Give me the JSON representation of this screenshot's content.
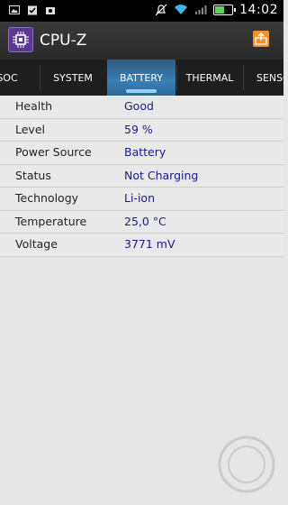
{
  "status_bar": {
    "time": "14:02",
    "battery_level": 0.59,
    "icons": [
      "image-icon",
      "clipboard-check-icon",
      "camera-icon",
      "alarm-off-icon",
      "wifi-icon",
      "signal-icon",
      "battery-icon"
    ]
  },
  "app": {
    "title": "CPU-Z"
  },
  "tabs": [
    {
      "label": "SOC"
    },
    {
      "label": "SYSTEM"
    },
    {
      "label": "BATTERY"
    },
    {
      "label": "THERMAL"
    },
    {
      "label": "SENSO"
    }
  ],
  "battery": {
    "rows": [
      {
        "label": "Health",
        "value": "Good"
      },
      {
        "label": "Level",
        "value": "59 %"
      },
      {
        "label": "Power Source",
        "value": "Battery"
      },
      {
        "label": "Status",
        "value": "Not Charging"
      },
      {
        "label": "Technology",
        "value": "Li-ion"
      },
      {
        "label": "Temperature",
        "value": "25,0 °C"
      },
      {
        "label": "Voltage",
        "value": "3771 mV"
      }
    ]
  },
  "colors": {
    "accent": "#3a7fb5",
    "value_text": "#1a1a8c",
    "share_button": "#f0922a"
  }
}
